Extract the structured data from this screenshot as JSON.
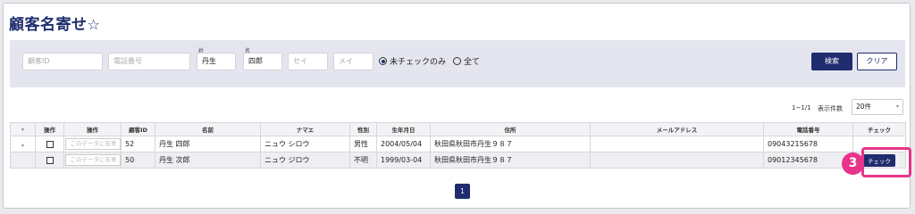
{
  "page": {
    "title": "顧客名寄せ",
    "star": "☆"
  },
  "search": {
    "customer_id_placeholder": "顧客ID",
    "phone_placeholder": "電話番号",
    "sei_label": "姓",
    "sei_value": "丹生",
    "mei_label": "名",
    "mei_value": "四郎",
    "sei_kana_placeholder": "セイ",
    "mei_kana_placeholder": "メイ",
    "radio_unchecked_label": "未チェックのみ",
    "radio_all_label": "全て",
    "search_button": "検索",
    "clear_button": "クリア"
  },
  "pagination": {
    "range": "1~1/1",
    "per_page_label": "表示件数",
    "per_page_value": "20件",
    "current_page": "1"
  },
  "table": {
    "headers": [
      "",
      "操作",
      "操作",
      "顧客ID",
      "名前",
      "ナマエ",
      "性別",
      "生年月日",
      "住所",
      "メールアドレス",
      "電話番号",
      "チェック"
    ],
    "row_placeholder": "このデータに名寄",
    "check_button": "チェック",
    "rows": [
      {
        "id": "52",
        "name": "丹生 四郎",
        "kana": "ニュウ シロウ",
        "gender": "男性",
        "birth": "2004/05/04",
        "address": "秋田県秋田市丹生９８７",
        "email": "",
        "phone": "09043215678"
      },
      {
        "id": "50",
        "name": "丹生 次郎",
        "kana": "ニュウ ジロウ",
        "gender": "不明",
        "birth": "1999/03-04",
        "address": "秋田県秋田市丹生９８７",
        "email": "",
        "phone": "09012345678"
      }
    ]
  },
  "annotation": {
    "step": "3"
  },
  "colors": {
    "accent": "#1f2c6e",
    "highlight": "#e8338a"
  }
}
